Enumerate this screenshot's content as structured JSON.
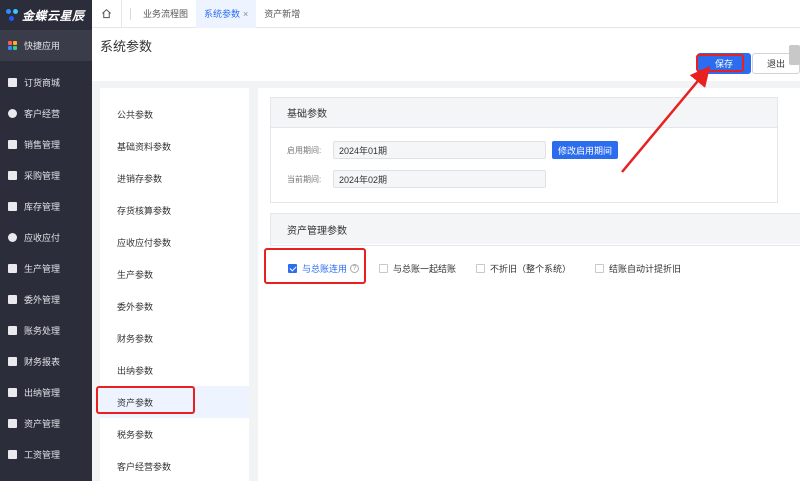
{
  "brand": {
    "name": "金蝶云星辰"
  },
  "sidebar": {
    "items": [
      {
        "label": "快捷应用",
        "icon": "grid-icon"
      },
      {
        "label": "订货商城",
        "icon": "bag-icon"
      },
      {
        "label": "客户经营",
        "icon": "user-icon"
      },
      {
        "label": "销售管理",
        "icon": "chart-icon"
      },
      {
        "label": "采购管理",
        "icon": "cart-icon"
      },
      {
        "label": "库存管理",
        "icon": "warehouse-icon"
      },
      {
        "label": "应收应付",
        "icon": "money-icon"
      },
      {
        "label": "生产管理",
        "icon": "factory-icon"
      },
      {
        "label": "委外管理",
        "icon": "outsource-icon"
      },
      {
        "label": "账务处理",
        "icon": "ledger-icon"
      },
      {
        "label": "财务报表",
        "icon": "report-icon"
      },
      {
        "label": "出纳管理",
        "icon": "cashier-icon"
      },
      {
        "label": "资产管理",
        "icon": "asset-icon"
      },
      {
        "label": "工资管理",
        "icon": "salary-icon"
      }
    ]
  },
  "tabs": [
    {
      "label": "业务流程图"
    },
    {
      "label": "系统参数",
      "close": "×"
    },
    {
      "label": "资产新增"
    }
  ],
  "header": {
    "title": "系统参数",
    "save_label": "保存",
    "exit_label": "退出"
  },
  "param_nav": {
    "items": [
      "公共参数",
      "基础资料参数",
      "进销存参数",
      "存货核算参数",
      "应收应付参数",
      "生产参数",
      "委外参数",
      "财务参数",
      "出纳参数",
      "资产参数",
      "税务参数",
      "客户经营参数"
    ],
    "active_index": 9
  },
  "basic_params": {
    "title": "基础参数",
    "start_period_label": "启用期间:",
    "start_period_value": "2024年01期",
    "modify_button": "修改启用期间",
    "current_period_label": "当前期间:",
    "current_period_value": "2024年02期"
  },
  "asset_params": {
    "title": "资产管理参数",
    "options": [
      {
        "label": "与总账连用",
        "checked": true,
        "help": "?"
      },
      {
        "label": "与总账一起结账",
        "checked": false
      },
      {
        "label": "不折旧（整个系统）",
        "checked": false
      },
      {
        "label": "结账自动计提折旧",
        "checked": false
      }
    ]
  },
  "colors": {
    "accent": "#2c6df0",
    "sidebar_bg": "#2b2d3a",
    "annotation": "#e8201f"
  }
}
